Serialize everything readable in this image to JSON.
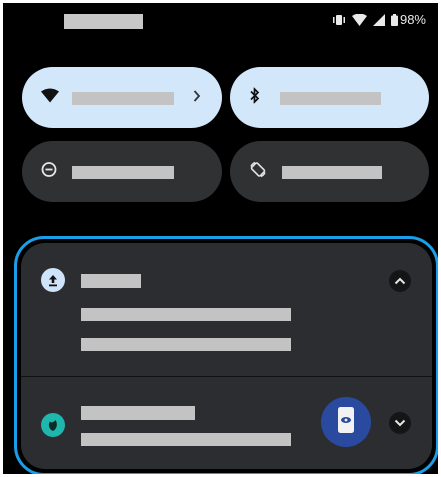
{
  "status_bar": {
    "battery": "98%",
    "icons": [
      "vibrate-icon",
      "wifi-icon",
      "signal-icon",
      "battery-icon"
    ]
  },
  "quick_settings": [
    {
      "id": "internet",
      "icon": "wifi-icon",
      "active": true,
      "has_chevron": true
    },
    {
      "id": "bluetooth",
      "icon": "bluetooth-icon",
      "active": true,
      "has_chevron": false
    },
    {
      "id": "do-not-disturb",
      "icon": "do-not-disturb-icon",
      "active": false,
      "has_chevron": false
    },
    {
      "id": "auto-rotate",
      "icon": "auto-rotate-icon",
      "active": false,
      "has_chevron": false
    }
  ],
  "notifications": [
    {
      "id": "upload",
      "icon": "upload-icon",
      "expanded": true
    },
    {
      "id": "app",
      "icon": "app-leaf-icon",
      "expanded": false,
      "has_thumbnail": true
    }
  ],
  "colors": {
    "accent_outline": "#1a9ee8",
    "tile_active": "#d3e7fb",
    "tile_inactive": "#2f3133",
    "notification_bg": "#2b2d30",
    "placeholder_text": "#c3c3c3"
  }
}
